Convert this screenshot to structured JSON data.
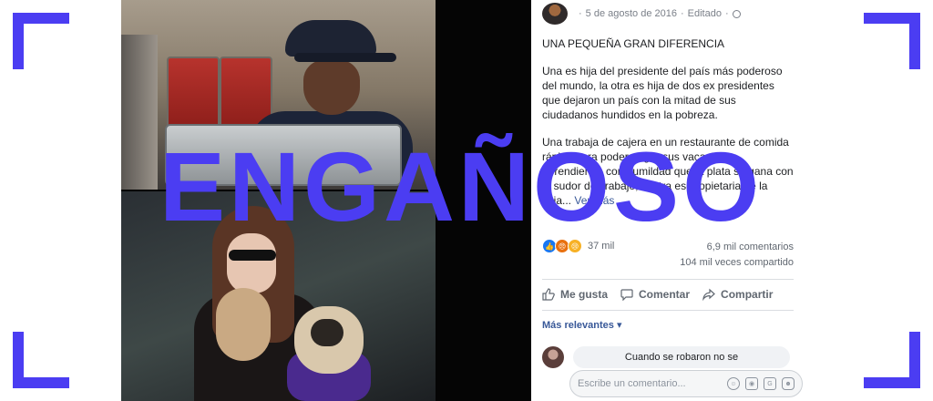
{
  "post": {
    "date": "5 de agosto de 2016",
    "separator": "·",
    "edited": "Editado",
    "separator2": "·",
    "title": "UNA PEQUEÑA GRAN DIFERENCIA",
    "paragraph1": "Una es hija del presidente del país más poderoso del mundo, la otra es hija de dos ex presidentes que dejaron un país con la mitad de sus ciudadanos hundidos en la pobreza.",
    "paragraph2": "Una trabaja de cajera en un restaurante de comida rápida para poder pagar sus vacaciones, aprendiendo con humildad que la plata se gana con el sudor del trabajo, la otra es propietaria de la caja...",
    "see_more": "Ver más",
    "reaction_count": "37 mil",
    "comments_count": "6,9 mil comentarios",
    "shares_count": "104 mil veces compartido",
    "actions": {
      "like": "Me gusta",
      "comment": "Comentar",
      "share": "Compartir"
    },
    "sort_label": "Más relevantes",
    "first_comment": "Cuando se robaron no se",
    "composer_placeholder": "Escribe un comentario..."
  },
  "overlay": {
    "verdict": "ENGAÑOSO"
  },
  "icons": {
    "reactions": [
      "like-icon",
      "angry-icon",
      "sad-icon"
    ],
    "composer": [
      "emoji-icon",
      "camera-icon",
      "gif-icon",
      "sticker-icon"
    ]
  },
  "colors": {
    "accent": "#4b3df2",
    "link": "#385898"
  }
}
